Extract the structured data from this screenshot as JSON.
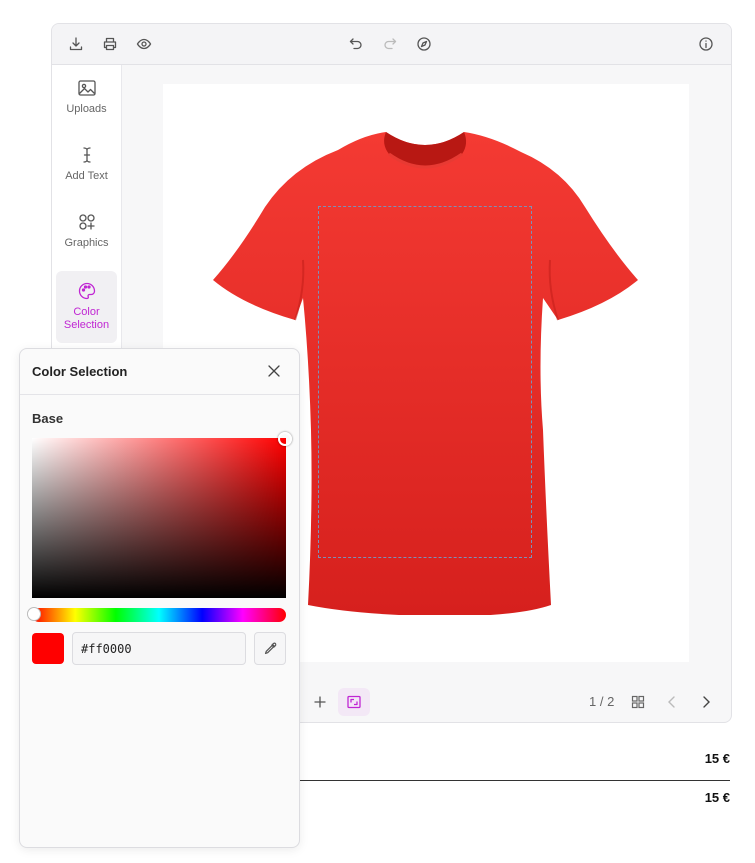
{
  "toolbar": {
    "left_icons": [
      "download-icon",
      "print-icon",
      "eye-icon"
    ],
    "center_icons": [
      "undo-icon",
      "redo-icon",
      "compass-icon"
    ],
    "right_icons": [
      "info-icon"
    ]
  },
  "sidebar": {
    "items": [
      {
        "label": "Uploads",
        "icon": "image-icon",
        "active": false
      },
      {
        "label": "Add Text",
        "icon": "text-cursor-icon",
        "active": false
      },
      {
        "label": "Graphics",
        "icon": "shapes-icon",
        "active": false
      },
      {
        "label": "Color\nSelection",
        "icon": "palette-icon",
        "active": true
      }
    ]
  },
  "canvas": {
    "product": "t-shirt",
    "product_color": "#ff0000"
  },
  "bottombar": {
    "page_indicator": "1 / 2"
  },
  "prices": [
    "15 €",
    "15 €"
  ],
  "color_panel": {
    "title": "Color Selection",
    "section_label": "Base",
    "hex_value": "#ff0000",
    "hue_color": "#ff0000"
  },
  "colors": {
    "accent": "#c026d3",
    "selected": "#ff0000"
  }
}
